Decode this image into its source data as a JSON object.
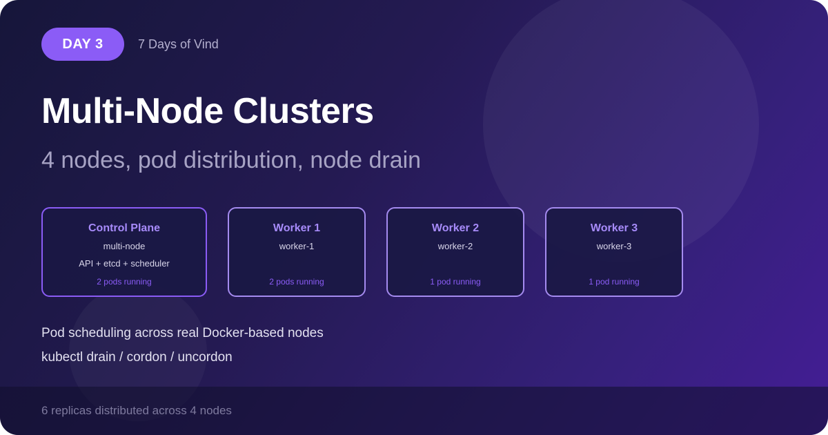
{
  "badge": "DAY 3",
  "series": "7 Days of Vind",
  "title": "Multi-Node Clusters",
  "subtitle": "4 nodes, pod distribution, node drain",
  "nodes": [
    {
      "title": "Control Plane",
      "name": "multi-node",
      "role": "API + etcd + scheduler",
      "pods": "2 pods running"
    },
    {
      "title": "Worker 1",
      "name": "worker-1",
      "pods": "2 pods running"
    },
    {
      "title": "Worker 2",
      "name": "worker-2",
      "pods": "1 pod running"
    },
    {
      "title": "Worker 3",
      "name": "worker-3",
      "pods": "1 pod running"
    }
  ],
  "features": [
    "Pod scheduling across real Docker-based nodes",
    "kubectl drain / cordon / uncordon"
  ],
  "footer": "6 replicas distributed across 4 nodes",
  "colors": {
    "accent": "#8b5cf6",
    "node_title": "#a78bfa",
    "background_start": "#16163a",
    "background_end": "#441d96"
  }
}
